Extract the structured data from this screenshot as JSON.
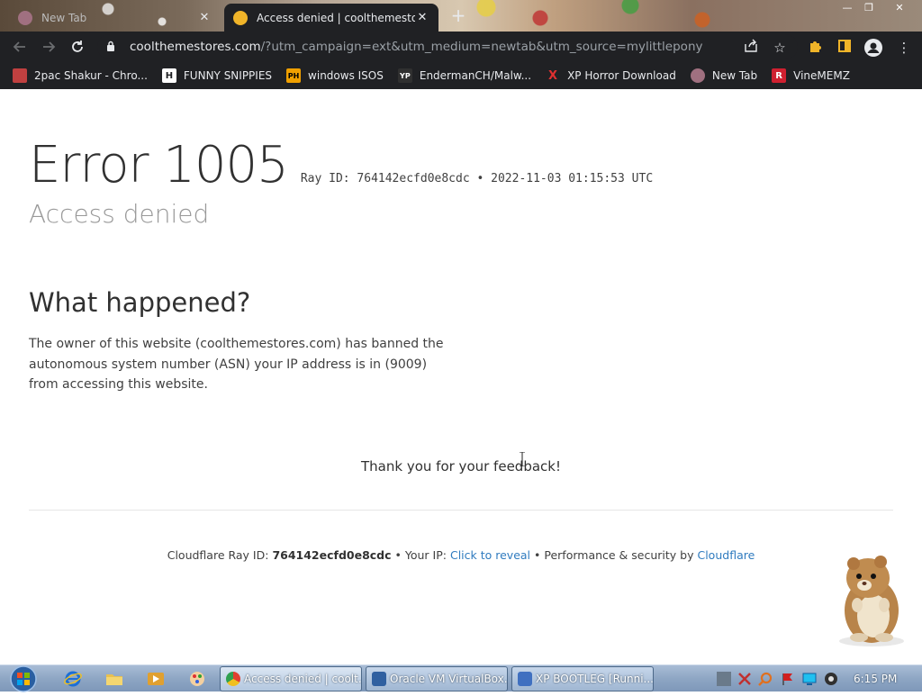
{
  "browser": {
    "tabs": [
      {
        "title": "New Tab",
        "close": "✕"
      },
      {
        "title": "Access denied | coolthemestores.com",
        "close": "✕"
      }
    ],
    "new_tab": "+",
    "window_controls": {
      "minimize": "—",
      "restore": "❐",
      "close": "✕"
    },
    "address": {
      "host": "coolthemestores.com",
      "path": "/?utm_campaign=ext&utm_medium=newtab&utm_source=mylittlepony"
    },
    "icons": {
      "back": "back-arrow-icon",
      "forward": "forward-arrow-icon",
      "reload": "reload-icon",
      "lock": "lock-icon",
      "share": "share-icon",
      "star": "star-icon",
      "extensions": "puzzle-icon",
      "sidepanel": "side-panel-icon",
      "profile": "profile-icon",
      "menu": "kebab-menu-icon"
    },
    "bookmarks": [
      {
        "label": "2pac Shakur - Chro...",
        "icon_text": "",
        "color": "#c04040"
      },
      {
        "label": "FUNNY SNIPPIES",
        "icon_text": "H",
        "color": "#202124"
      },
      {
        "label": "windows ISOS",
        "icon_text": "PH",
        "color": "#f0a000"
      },
      {
        "label": "EndermanCH/Malw...",
        "icon_text": "YP",
        "color": "#303030"
      },
      {
        "label": "XP Horror Download",
        "icon_text": "X",
        "color": "#202124"
      },
      {
        "label": "New Tab",
        "icon_text": "",
        "color": "#a07080"
      },
      {
        "label": "VineMEMZ",
        "icon_text": "R",
        "color": "#d02030"
      }
    ]
  },
  "page": {
    "error_code": "Error 1005",
    "ray_info": "Ray ID: 764142ecfd0e8cdc •  2022-11-03 01:15:53 UTC",
    "subtitle": "Access denied",
    "what_title": "What happened?",
    "what_body": "The owner of this website (coolthemestores.com) has banned the autonomous system number (ASN) your IP address is in (9009) from accessing this website.",
    "feedback": "Thank you for your feedback!",
    "footer": {
      "ray_label": "Cloudflare Ray ID:",
      "ray_id": "764142ecfd0e8cdc",
      "sep1": "•",
      "ip_label": "Your IP:",
      "ip_link": "Click to reveal",
      "sep2": "•",
      "perf_label": "Performance & security by",
      "cf_link": "Cloudflare"
    }
  },
  "taskbar": {
    "tasks": [
      {
        "label": "Access denied | coolt...",
        "color": "#e04030"
      },
      {
        "label": "Oracle VM VirtualBox...",
        "color": "#3060a0"
      },
      {
        "label": "XP BOOTLEG [Runni...",
        "color": "#4070c0"
      }
    ],
    "clock": "6:15 PM"
  }
}
